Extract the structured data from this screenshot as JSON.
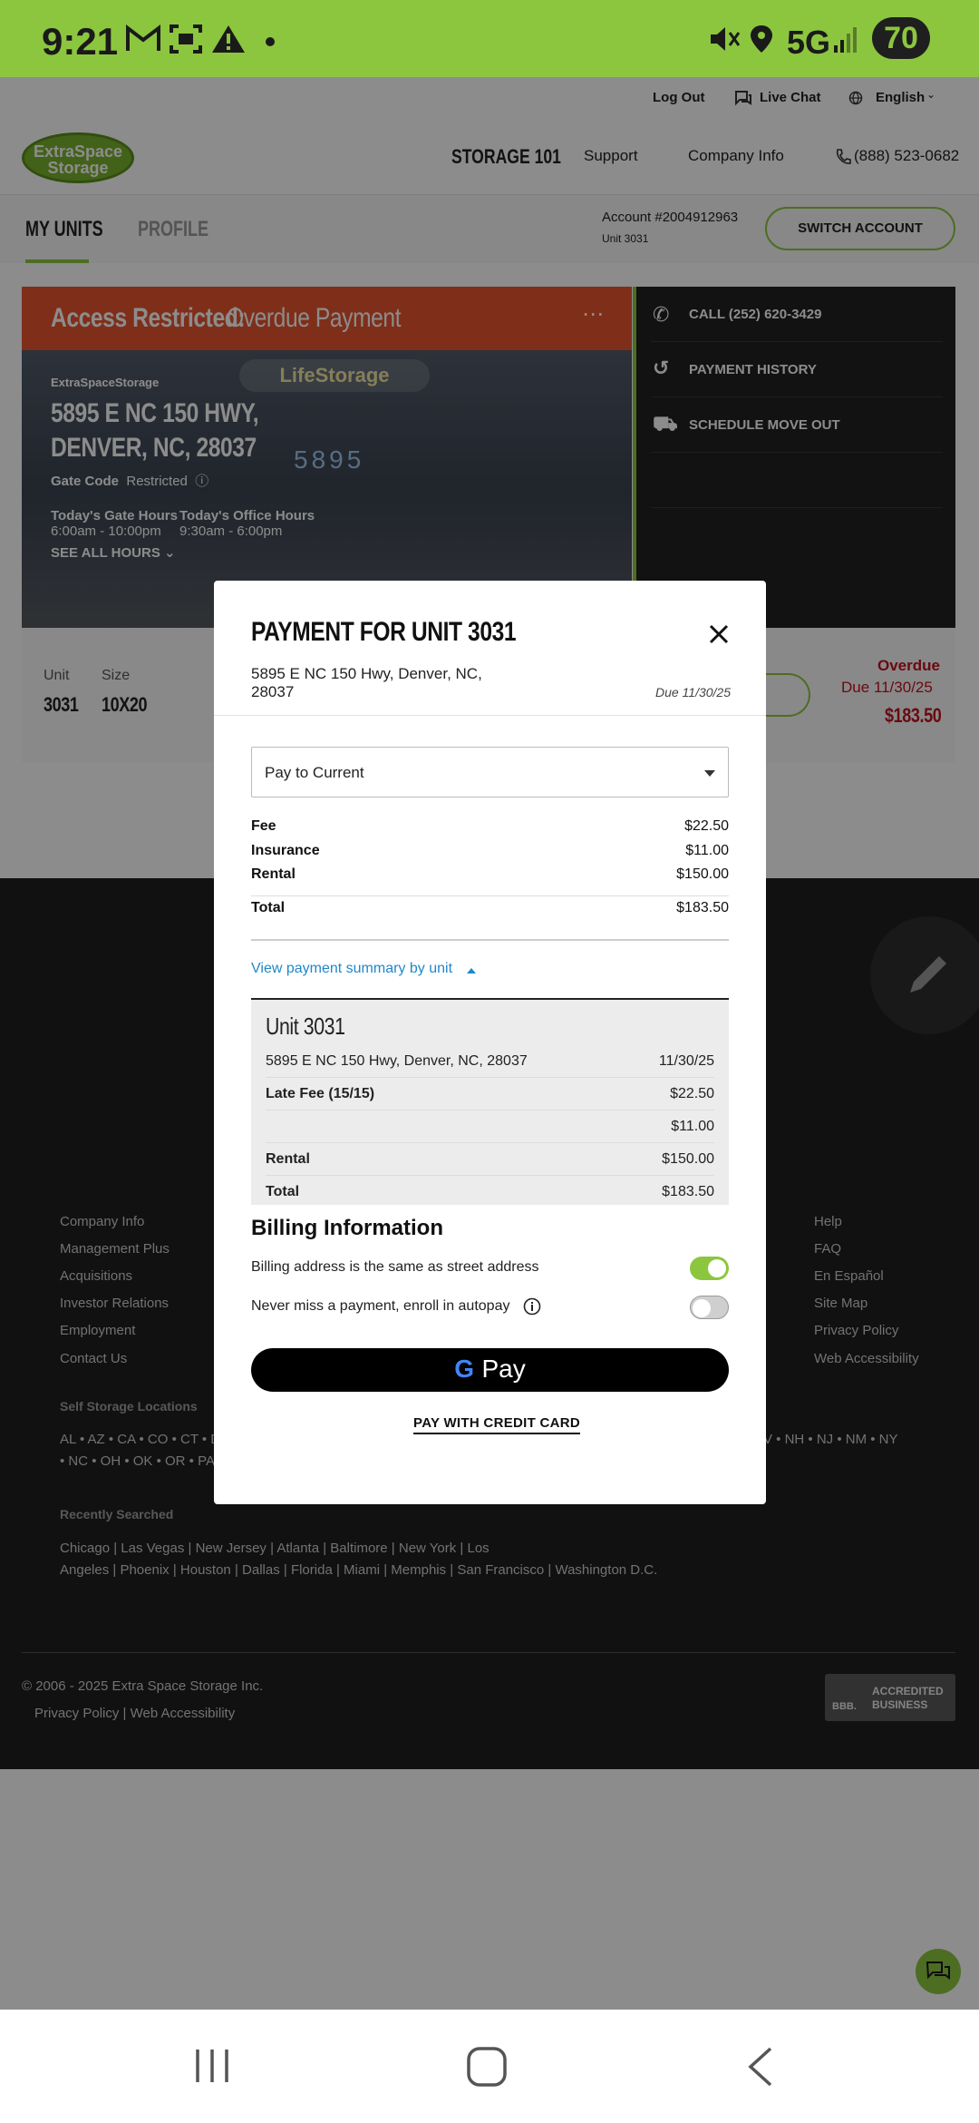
{
  "status_bar": {
    "time": "9:21",
    "network": "5G",
    "battery": "70"
  },
  "utility": {
    "logout": "Log Out",
    "live_chat": "Live Chat",
    "language": "English"
  },
  "header": {
    "logo_line1": "ExtraSpace",
    "logo_line2": "Storage",
    "nav": [
      "STORAGE 101",
      "Support",
      "Company Info"
    ],
    "phone": "(888) 523-0682"
  },
  "tabs": {
    "my_units": "MY UNITS",
    "profile": "PROFILE"
  },
  "account": {
    "number": "Account #2004912963",
    "unit": "Unit 3031",
    "switch": "SWITCH ACCOUNT"
  },
  "unit_card": {
    "restricted_label": "Access Restricted:",
    "restricted_reason": "Overdue Payment",
    "brand": "ExtraSpaceStorage",
    "address_line1": "5895 E NC 150 HWY,",
    "address_line2": "DENVER, NC, 28037",
    "gate_code_label": "Gate Code",
    "gate_code_value": "Restricted",
    "gate_hours_label": "Today's Gate Hours",
    "gate_hours": "6:00am - 10:00pm",
    "office_hours_label": "Today's Office Hours",
    "office_hours": "9:30am - 6:00pm",
    "see_all": "SEE ALL HOURS",
    "photo_sign": "LifeStorage",
    "photo_number": "5895",
    "actions": [
      "CALL (252) 620-3429",
      "PAYMENT HISTORY",
      "SCHEDULE MOVE OUT"
    ],
    "unit_label": "Unit",
    "unit_value": "3031",
    "size_label": "Size",
    "size_value": "10X20",
    "overdue": "Overdue",
    "due_date": "Due 11/30/25",
    "due_amount": "$183.50"
  },
  "footer": {
    "col1": [
      "Company Info",
      "Management Plus",
      "Acquisitions",
      "Investor Relations",
      "Employment",
      "Contact Us"
    ],
    "col2": [
      "Help",
      "FAQ",
      "En Español",
      "Site Map",
      "Privacy Policy",
      "Web Accessibility"
    ],
    "locations_title": "Self Storage Locations",
    "states_left_1": "AL • AZ • CA • CO • CT • D",
    "states_right_1": "V • NH • NJ • NM • NY",
    "states_left_2": "• NC • OH • OK • OR • PA",
    "recent_title": "Recently Searched",
    "recent_1": [
      "Chicago",
      "Las Vegas",
      "New Jersey",
      "Atlanta",
      "Baltimore",
      "New York",
      "Los"
    ],
    "recent_2": [
      "Angeles",
      "Phoenix",
      "Houston",
      "Dallas",
      "Florida",
      "Miami",
      "Memphis",
      "San Francisco",
      "Washington D.C."
    ],
    "copyright": "© 2006 - 2025 Extra Space Storage Inc.",
    "privacy": "Privacy Policy",
    "accessibility": "Web Accessibility",
    "bbb_line1": "ACCREDITED",
    "bbb_line2": "BUSINESS",
    "bbb_logo": "BBB."
  },
  "modal": {
    "title": "PAYMENT FOR UNIT 3031",
    "address": "5895 E NC 150 Hwy, Denver, NC, 28037",
    "due": "Due 11/30/25",
    "pay_option": "Pay to Current",
    "lines": [
      {
        "label": "Fee",
        "value": "$22.50"
      },
      {
        "label": "Insurance",
        "value": "$11.00"
      },
      {
        "label": "Rental",
        "value": "$150.00"
      }
    ],
    "total_label": "Total",
    "total_value": "$183.50",
    "summary_link": "View payment summary by unit",
    "summary": {
      "unit_title": "Unit 3031",
      "address": "5895 E NC 150 Hwy, Denver, NC, 28037",
      "date": "11/30/25",
      "rows": [
        {
          "label": "Late Fee (15/15)",
          "value": "$22.50"
        },
        {
          "label": "",
          "value": "$11.00"
        },
        {
          "label": "Rental",
          "value": "$150.00"
        },
        {
          "label": "Total",
          "value": "$183.50"
        }
      ]
    },
    "billing_title": "Billing Information",
    "billing_same": "Billing address is the same as street address",
    "billing_same_on": true,
    "autopay": "Never miss a payment, enroll in autopay",
    "autopay_on": false,
    "gpay_g": "G",
    "gpay_label": "Pay",
    "credit_card": "PAY WITH CREDIT CARD"
  },
  "colors": {
    "brand_green": "#8cc63f",
    "alert_orange": "#e8542f",
    "link_blue": "#1f88c9",
    "overdue_red": "#c1121f"
  }
}
